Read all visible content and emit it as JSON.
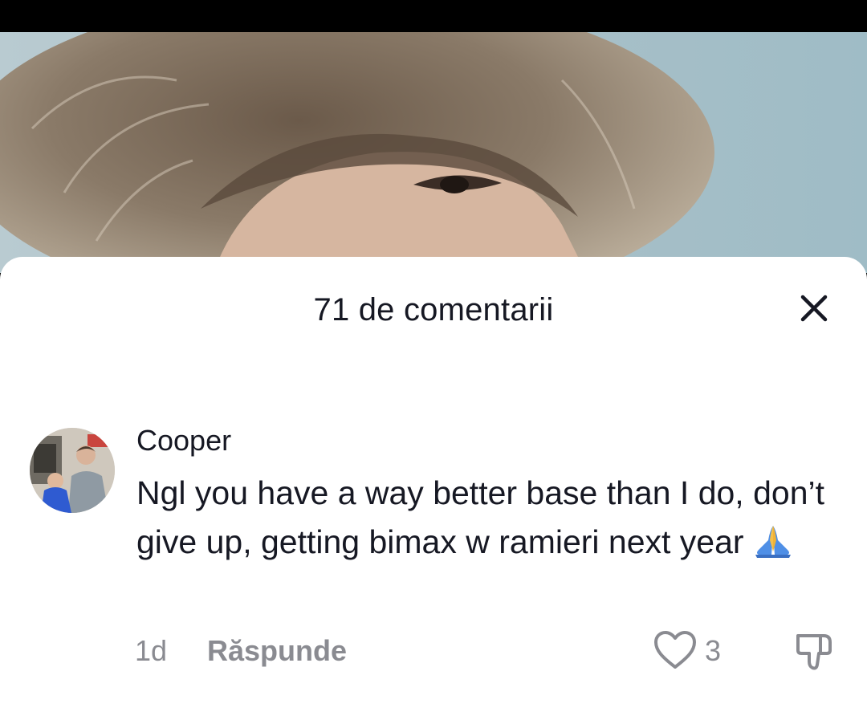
{
  "sheet": {
    "title": "71 de comentarii",
    "close_icon": "close-icon"
  },
  "comment": {
    "username": "Cooper",
    "text": "Ngl you have a way better base than I do, don’t give up, getting bimax w ramieri next year",
    "emoji": "🙏",
    "time": "1d",
    "reply_label": "Răspunde",
    "like_count": "3",
    "icons": [
      "heart-icon",
      "thumbs-down-icon"
    ]
  },
  "colors": {
    "text_primary": "#161823",
    "text_secondary": "#8a8b91",
    "sheet_bg": "#ffffff"
  }
}
